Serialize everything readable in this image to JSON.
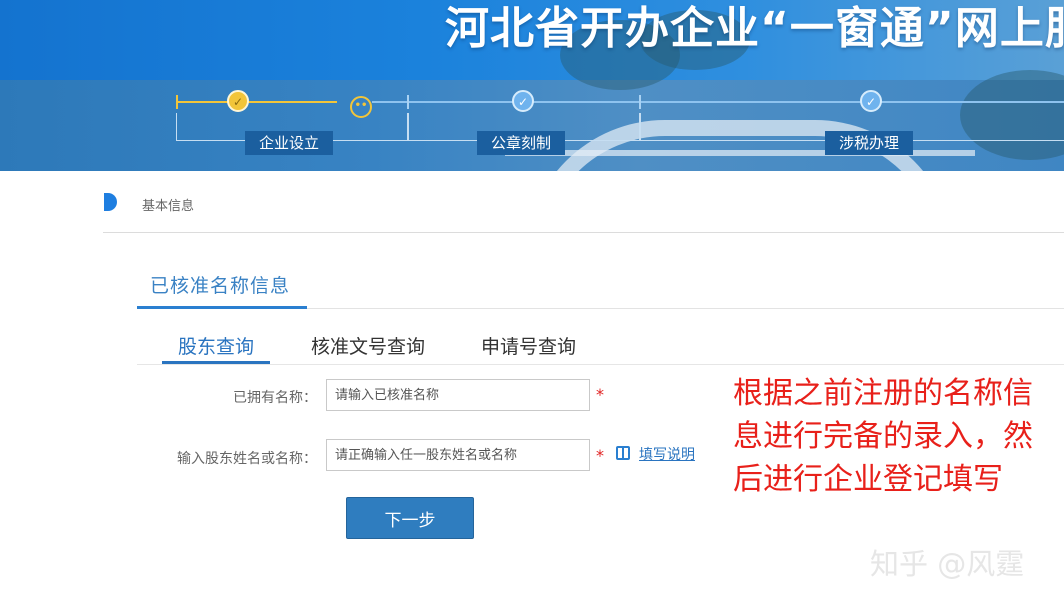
{
  "banner": {
    "title": "河北省开办企业“一窗通”网上服"
  },
  "steps": [
    {
      "label": "企业设立",
      "state": "current"
    },
    {
      "label": "公章刻制",
      "state": "pending"
    },
    {
      "label": "涉税办理",
      "state": "pending"
    }
  ],
  "section": {
    "title": "基本信息"
  },
  "panel": {
    "title": "已核准名称信息",
    "tabs": [
      {
        "label": "股东查询",
        "active": true
      },
      {
        "label": "核准文号查询",
        "active": false
      },
      {
        "label": "申请号查询",
        "active": false
      }
    ]
  },
  "form": {
    "name_label": "已拥有名称：",
    "name_placeholder": "请输入已核准名称",
    "shareholder_label": "输入股东姓名或名称：",
    "shareholder_placeholder": "请正确输入任一股东姓名或名称",
    "required_mark": "*",
    "help_link": "填写说明",
    "next_button": "下一步"
  },
  "annotation": {
    "text": "根据之前注册的名称信息进行完备的录入，然后进行企业登记填写"
  },
  "watermark": {
    "text": "知乎 @风霆"
  },
  "colors": {
    "accent": "#2a74c0",
    "step_active": "#f2c53a",
    "required": "#e02020",
    "annotation": "#e8201a",
    "button": "#2f7dbf"
  }
}
